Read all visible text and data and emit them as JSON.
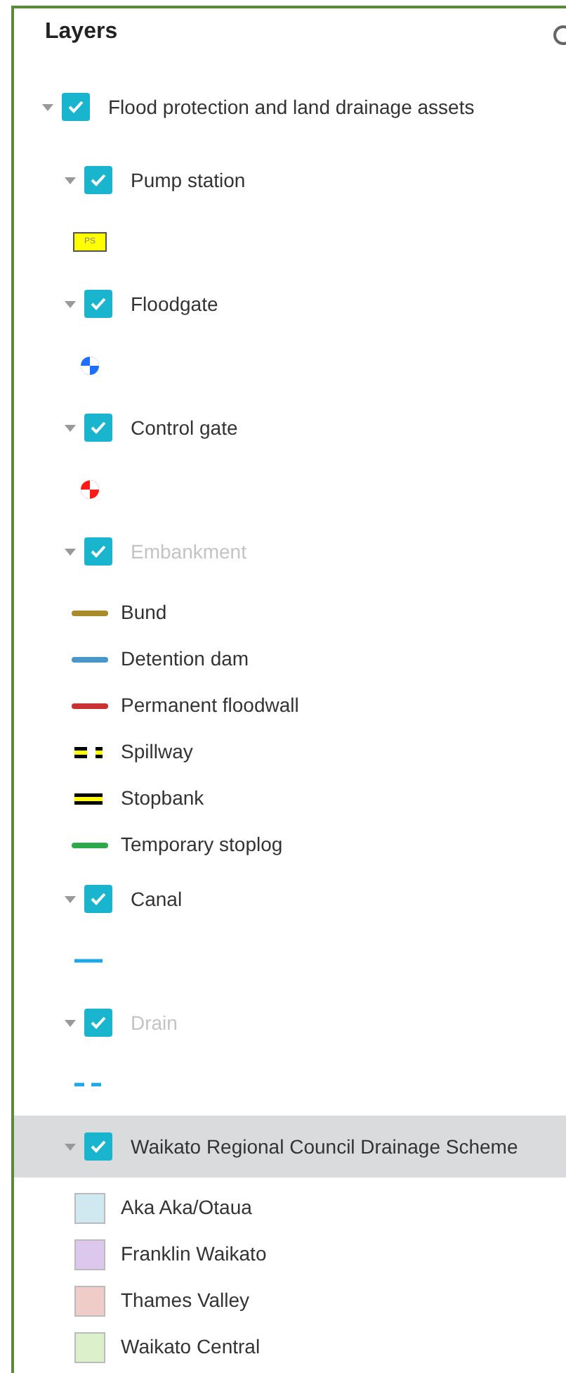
{
  "panel": {
    "title": "Layers"
  },
  "layers": [
    {
      "label": "Flood protection and land drainage assets",
      "checked": true,
      "expanded": true,
      "in_scale": true,
      "highlighted": false,
      "children": [
        {
          "label": "Pump station",
          "checked": true,
          "expanded": true,
          "in_scale": true,
          "highlighted": false,
          "legend": [
            {
              "kind": "box_text",
              "text": "PS",
              "color": "#ffff00"
            }
          ]
        },
        {
          "label": "Floodgate",
          "checked": true,
          "expanded": true,
          "in_scale": true,
          "highlighted": false,
          "legend": [
            {
              "kind": "quartered_circle",
              "color": "#1f6fff"
            }
          ]
        },
        {
          "label": "Control gate",
          "checked": true,
          "expanded": true,
          "in_scale": true,
          "highlighted": false,
          "legend": [
            {
              "kind": "quartered_circle",
              "color": "#ff1a1a"
            }
          ]
        },
        {
          "label": "Embankment",
          "checked": true,
          "expanded": true,
          "in_scale": false,
          "highlighted": false,
          "legend": [
            {
              "kind": "line",
              "label": "Bund",
              "color": "#a88a2a"
            },
            {
              "kind": "line",
              "label": "Detention dam",
              "color": "#4a96c8"
            },
            {
              "kind": "line",
              "label": "Permanent floodwall",
              "color": "#c83232"
            },
            {
              "kind": "spillway",
              "label": "Spillway",
              "color": "#ffff00"
            },
            {
              "kind": "double_line",
              "label": "Stopbank",
              "color": "#ffff00"
            },
            {
              "kind": "line",
              "label": "Temporary stoplog",
              "color": "#2ea84a"
            }
          ]
        },
        {
          "label": "Canal",
          "checked": true,
          "expanded": true,
          "in_scale": true,
          "highlighted": false,
          "legend": [
            {
              "kind": "thin_line",
              "color": "#1aa8e8"
            }
          ]
        },
        {
          "label": "Drain",
          "checked": true,
          "expanded": true,
          "in_scale": false,
          "highlighted": false,
          "legend": [
            {
              "kind": "dashed_line",
              "color": "#1aa8e8"
            }
          ]
        },
        {
          "label": "Waikato Regional Council Drainage Scheme",
          "checked": true,
          "expanded": true,
          "in_scale": true,
          "highlighted": true,
          "legend": [
            {
              "kind": "swatch",
              "label": "Aka Aka/Otaua",
              "color": "#d0e8f0"
            },
            {
              "kind": "swatch",
              "label": "Franklin Waikato",
              "color": "#dcc8ec"
            },
            {
              "kind": "swatch",
              "label": "Thames Valley",
              "color": "#f0ccc8"
            },
            {
              "kind": "swatch",
              "label": "Waikato Central",
              "color": "#dcf0cc"
            }
          ]
        }
      ]
    }
  ]
}
